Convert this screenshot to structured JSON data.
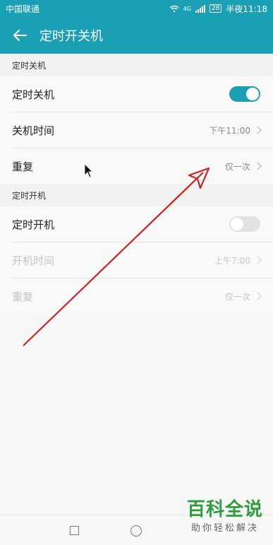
{
  "status_bar": {
    "carrier": "中国联通",
    "network": "4G",
    "battery": "28",
    "time": "半夜11:18"
  },
  "app_bar": {
    "title": "定时开关机",
    "back_icon": "arrow-left-icon"
  },
  "shutdown_section": {
    "header": "定时关机",
    "toggle_label": "定时关机",
    "toggle_on": true,
    "time_label": "关机时间",
    "time_value": "下午11:00",
    "repeat_label": "重复",
    "repeat_value": "仅一次"
  },
  "startup_section": {
    "header": "定时开机",
    "toggle_label": "定时开机",
    "toggle_on": false,
    "time_label": "开机时间",
    "time_value": "上午7:00",
    "repeat_label": "重复",
    "repeat_value": "仅一次"
  },
  "nav_bar": {
    "recents_icon": "square-icon",
    "home_icon": "circle-icon"
  },
  "watermark": {
    "title": "百科全说",
    "subtitle": "助你轻松解决"
  },
  "colors": {
    "accent": "#1aa0b4",
    "annotation_arrow": "#d42020",
    "watermark_green": "#2e9d3c"
  }
}
